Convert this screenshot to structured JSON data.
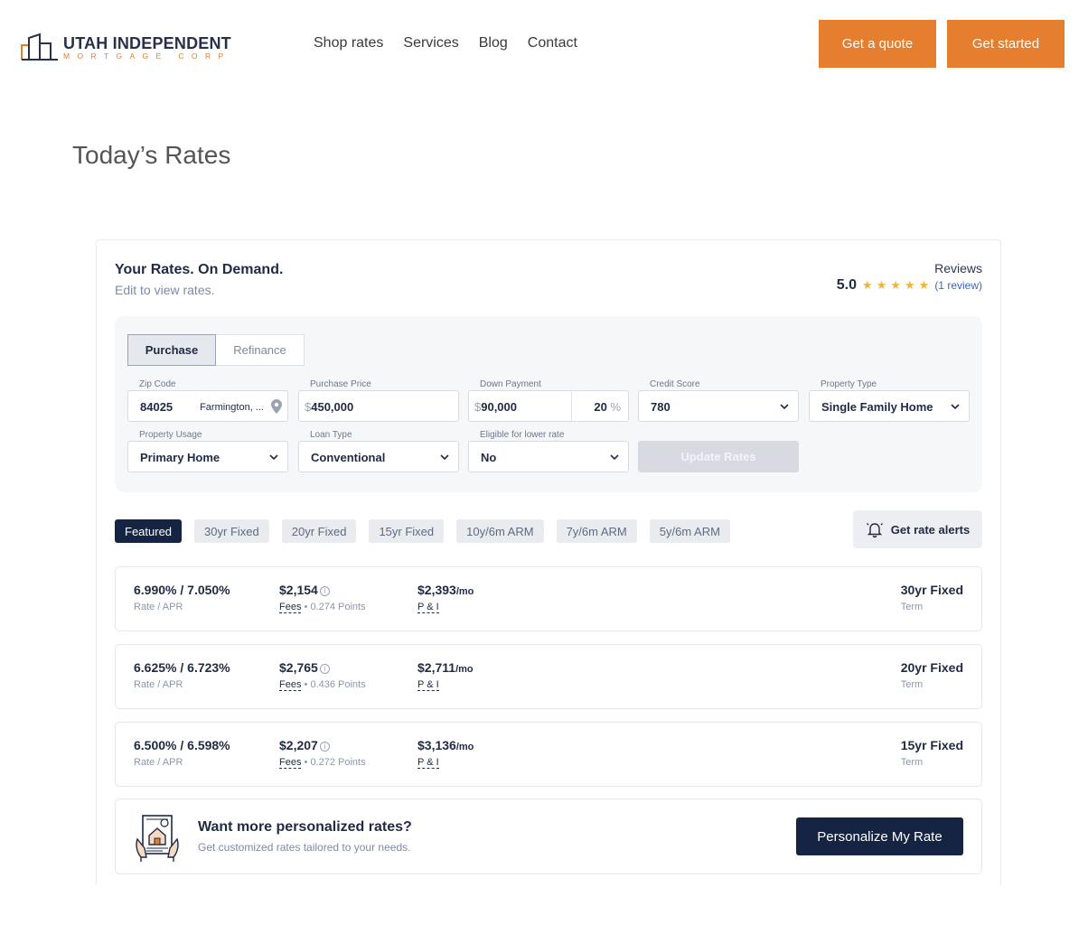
{
  "header": {
    "logo_main": "UTAH INDEPENDENT",
    "logo_sub": "MORTGAGE CORP",
    "nav": [
      "Shop rates",
      "Services",
      "Blog",
      "Contact"
    ],
    "quote_label": "Get a quote",
    "started_label": "Get started"
  },
  "page_title": "Today’s Rates",
  "widget": {
    "title": "Your Rates. On Demand.",
    "subtitle": "Edit to view rates.",
    "reviews_label": "Reviews",
    "score": "5.0",
    "stars": 5,
    "review_link": "(1 review)"
  },
  "form": {
    "seg": [
      "Purchase",
      "Refinance"
    ],
    "zip_label": "Zip Code",
    "zip_value": "84025",
    "zip_location": "Farmington, ...",
    "price_label": "Purchase Price",
    "price_prefix": "$",
    "price_value": "450,000",
    "down_label": "Down Payment",
    "down_prefix": "$",
    "down_value": "90,000",
    "down_pct": "20",
    "down_pct_sign": "%",
    "credit_label": "Credit Score",
    "credit_value": "780",
    "ptype_label": "Property Type",
    "ptype_value": "Single Family Home",
    "usage_label": "Property Usage",
    "usage_value": "Primary Home",
    "loan_label": "Loan Type",
    "loan_value": "Conventional",
    "eligible_label": "Eligible for lower rate",
    "eligible_value": "No",
    "update_label": "Update Rates"
  },
  "tabs": [
    "Featured",
    "30yr Fixed",
    "20yr Fixed",
    "15yr Fixed",
    "10y/6m ARM",
    "7y/6m ARM",
    "5y/6m ARM"
  ],
  "alerts_label": "Get rate alerts",
  "rates": [
    {
      "rate_apr": "6.990% / 7.050%",
      "rate_label": "Rate / APR",
      "fees": "$2,154",
      "fees_label": "Fees",
      "points": "• 0.274 Points",
      "payment": "$2,393",
      "per": "/mo",
      "pi_label": "P & I",
      "term": "30yr Fixed",
      "term_label": "Term"
    },
    {
      "rate_apr": "6.625% / 6.723%",
      "rate_label": "Rate / APR",
      "fees": "$2,765",
      "fees_label": "Fees",
      "points": "• 0.436 Points",
      "payment": "$2,711",
      "per": "/mo",
      "pi_label": "P & I",
      "term": "20yr Fixed",
      "term_label": "Term"
    },
    {
      "rate_apr": "6.500% / 6.598%",
      "rate_label": "Rate / APR",
      "fees": "$2,207",
      "fees_label": "Fees",
      "points": "• 0.272 Points",
      "payment": "$3,136",
      "per": "/mo",
      "pi_label": "P & I",
      "term": "15yr Fixed",
      "term_label": "Term"
    }
  ],
  "personalize": {
    "title": "Want more personalized rates?",
    "subtitle": "Get customized rates tailored to your needs.",
    "button": "Personalize My Rate"
  },
  "colors": {
    "accent": "#e67e30",
    "navy": "#162443",
    "star": "#f0b43c"
  },
  "icons": [
    "location-pin-icon",
    "chevron-down-icon",
    "bell-icon",
    "info-icon",
    "star-icon",
    "document-house-icon"
  ]
}
